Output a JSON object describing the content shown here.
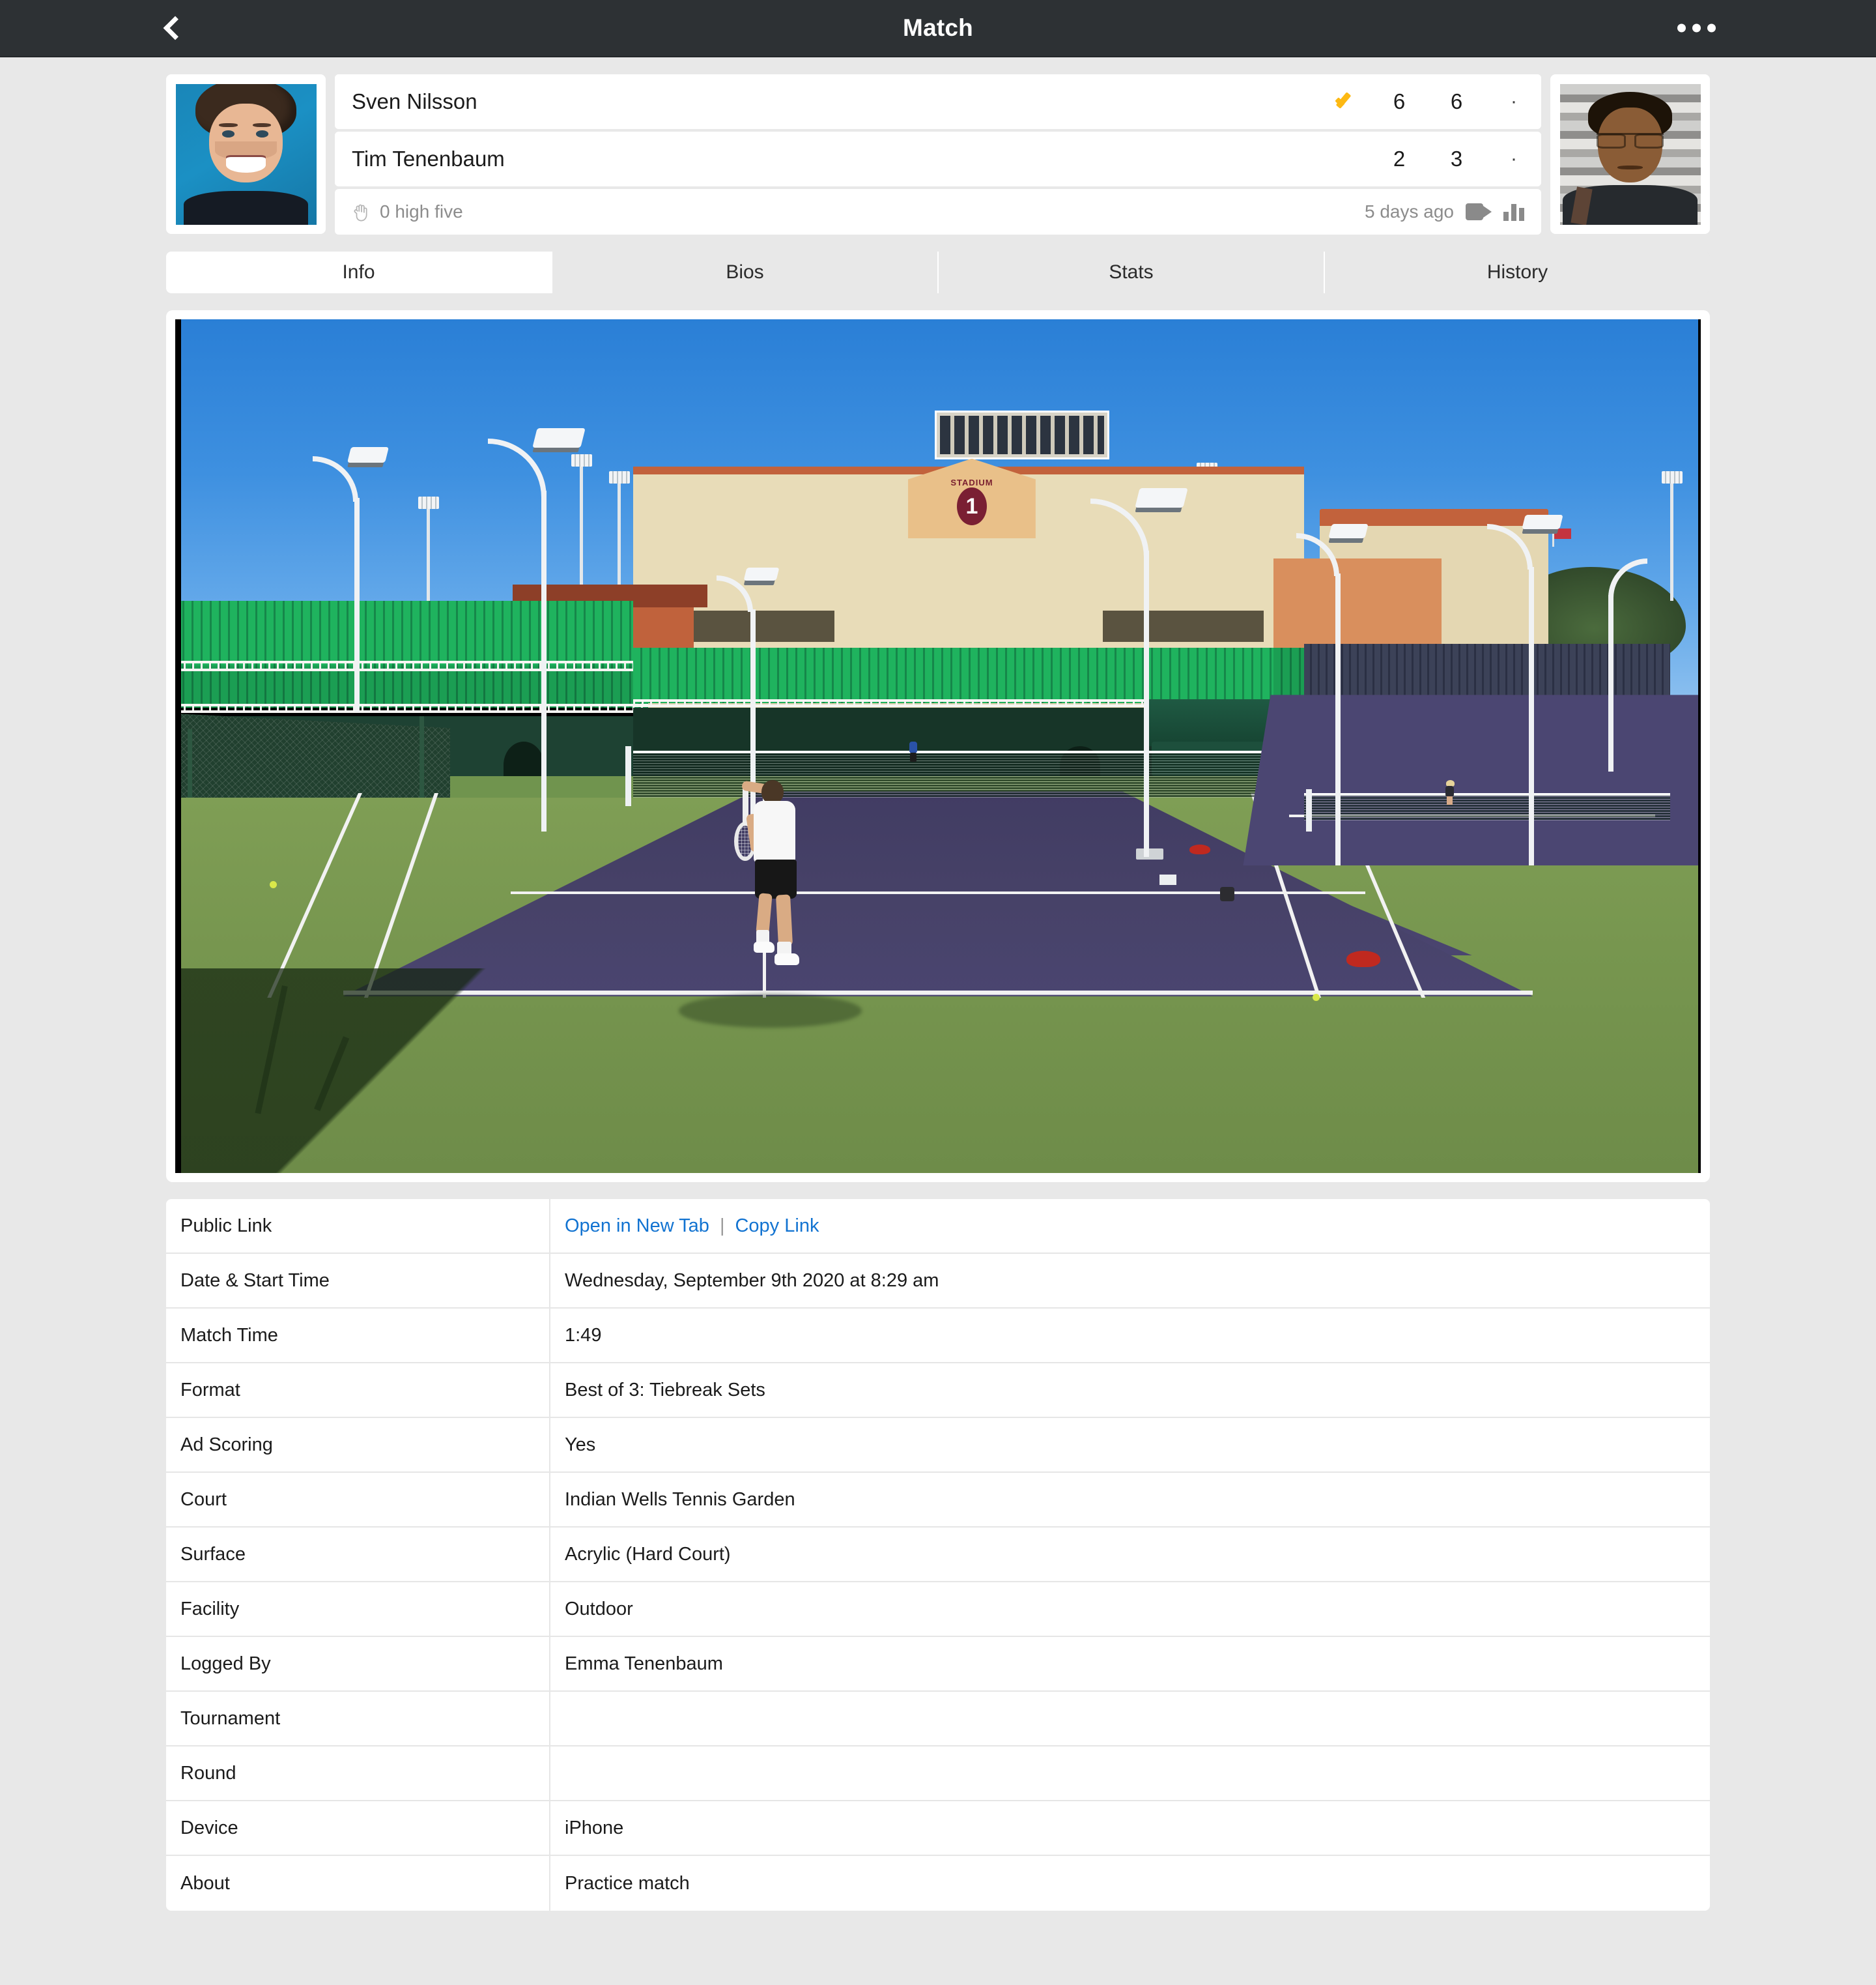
{
  "topbar": {
    "back_icon": "chevron-left-icon",
    "title": "Match",
    "menu_icon": "ellipsis-icon"
  },
  "scorecard": {
    "players": [
      {
        "name": "Sven Nilsson",
        "winner": true,
        "winner_icon": "checkmark-icon",
        "sets": [
          "6",
          "6",
          "·"
        ],
        "avatar_name": "avatar-sven-nilsson"
      },
      {
        "name": "Tim Tenenbaum",
        "winner": false,
        "sets": [
          "2",
          "3",
          "·"
        ],
        "avatar_name": "avatar-tim-tenenbaum"
      }
    ],
    "high_five": {
      "icon": "raised-hand-icon",
      "label": "0 high five"
    },
    "timestamp": "5 days ago",
    "video_icon": "video-camera-icon",
    "stats_icon": "bar-chart-icon",
    "accent_check_color": "#fdb913"
  },
  "tabs": [
    {
      "label": "Info",
      "active": true
    },
    {
      "label": "Bios",
      "active": false
    },
    {
      "label": "Stats",
      "active": false
    },
    {
      "label": "History",
      "active": false
    }
  ],
  "photo": {
    "alt": "Tennis player hitting a forehand on an outdoor hard court at Indian Wells Tennis Garden",
    "stadium_label": "STADIUM",
    "stadium_number": "1",
    "sky_color": "#3e90e0",
    "court_color": "#474268",
    "apron_color": "#77964f",
    "seat_color": "#1fb35e",
    "backwall_color": "#1e4233"
  },
  "info": {
    "rows": [
      {
        "label": "Public Link",
        "type": "links",
        "links": [
          "Open in New Tab",
          "Copy Link"
        ],
        "separator": "|"
      },
      {
        "label": "Date & Start Time",
        "type": "text",
        "value": "Wednesday, September 9th 2020 at 8:29 am"
      },
      {
        "label": "Match Time",
        "type": "text",
        "value": "1:49"
      },
      {
        "label": "Format",
        "type": "text",
        "value": "Best of 3: Tiebreak Sets"
      },
      {
        "label": "Ad Scoring",
        "type": "text",
        "value": "Yes"
      },
      {
        "label": "Court",
        "type": "text",
        "value": "Indian Wells Tennis Garden"
      },
      {
        "label": "Surface",
        "type": "text",
        "value": "Acrylic (Hard Court)"
      },
      {
        "label": "Facility",
        "type": "text",
        "value": "Outdoor"
      },
      {
        "label": "Logged By",
        "type": "text",
        "value": "Emma Tenenbaum"
      },
      {
        "label": "Tournament",
        "type": "text",
        "value": ""
      },
      {
        "label": "Round",
        "type": "text",
        "value": ""
      },
      {
        "label": "Device",
        "type": "text",
        "value": "iPhone"
      },
      {
        "label": "About",
        "type": "text",
        "value": "Practice match"
      }
    ]
  }
}
